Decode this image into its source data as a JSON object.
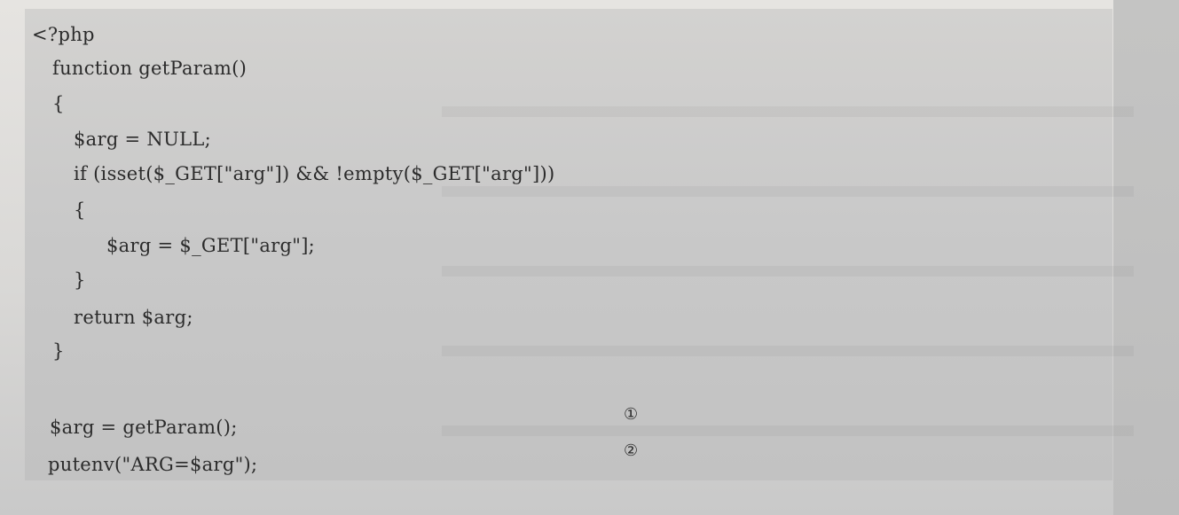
{
  "code": {
    "lines": [
      "<?php",
      "function getParam()",
      "{",
      "$arg = NULL;",
      "if (isset($_GET[\"arg\"]) && !empty($_GET[\"arg\"]))",
      "{",
      "$arg = $_GET[\"arg\"];",
      "}",
      "return $arg;",
      "}",
      "$arg = getParam();",
      "putenv(\"ARG=$arg\");"
    ],
    "markers": [
      "①",
      "②"
    ]
  }
}
